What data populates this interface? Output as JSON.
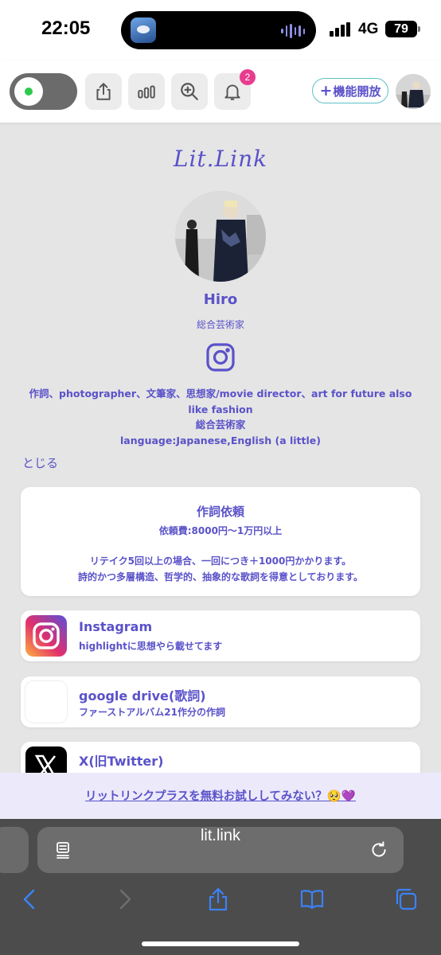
{
  "status_bar": {
    "time": "22:05",
    "network": "4G",
    "battery": "79"
  },
  "header": {
    "notification_count": "2",
    "feature_button_plus": "+",
    "feature_button_label": "機能開放",
    "icons": [
      "toggle",
      "share-icon",
      "stats-icon",
      "zoom-icon",
      "bell-icon"
    ]
  },
  "profile": {
    "logo": "Lit.Link",
    "name": "Hiro",
    "subtitle": "総合芸術家",
    "bio_lines": [
      "作詞、photographer、文筆家、思想家/movie director、art for future also",
      "like fashion",
      "総合芸術家",
      "language:Japanese,English (a little)"
    ],
    "close_label": "とじる"
  },
  "text_card": {
    "title": "作詞依頼",
    "line1": "依頼費:8000円〜1万円以上",
    "line2": "リテイク5回以上の場合、一回につき＋1000円かかります。",
    "line3": "詩的かつ多層構造、哲学的、抽象的な歌詞を得意としております。"
  },
  "links": [
    {
      "title": "Instagram",
      "subtitle": "highlightに思想やら載せてます",
      "icon": "instagram-icon"
    },
    {
      "title": "google drive(歌詞)",
      "subtitle": "ファーストアルバム21作分の作詞",
      "icon": "google-drive-icon"
    },
    {
      "title": "X(旧Twitter)",
      "subtitle": "",
      "icon": "x-icon"
    }
  ],
  "promo": {
    "text": "リットリンクプラスを無料お試ししてみない？🥺💜"
  },
  "browser": {
    "url": "lit.link"
  },
  "colors": {
    "accent": "#5a52c9",
    "badge": "#e83c8e",
    "feature_border": "#5ec1c6",
    "toggle_dot": "#2ec94b",
    "safari_blue": "#3b82f6"
  }
}
